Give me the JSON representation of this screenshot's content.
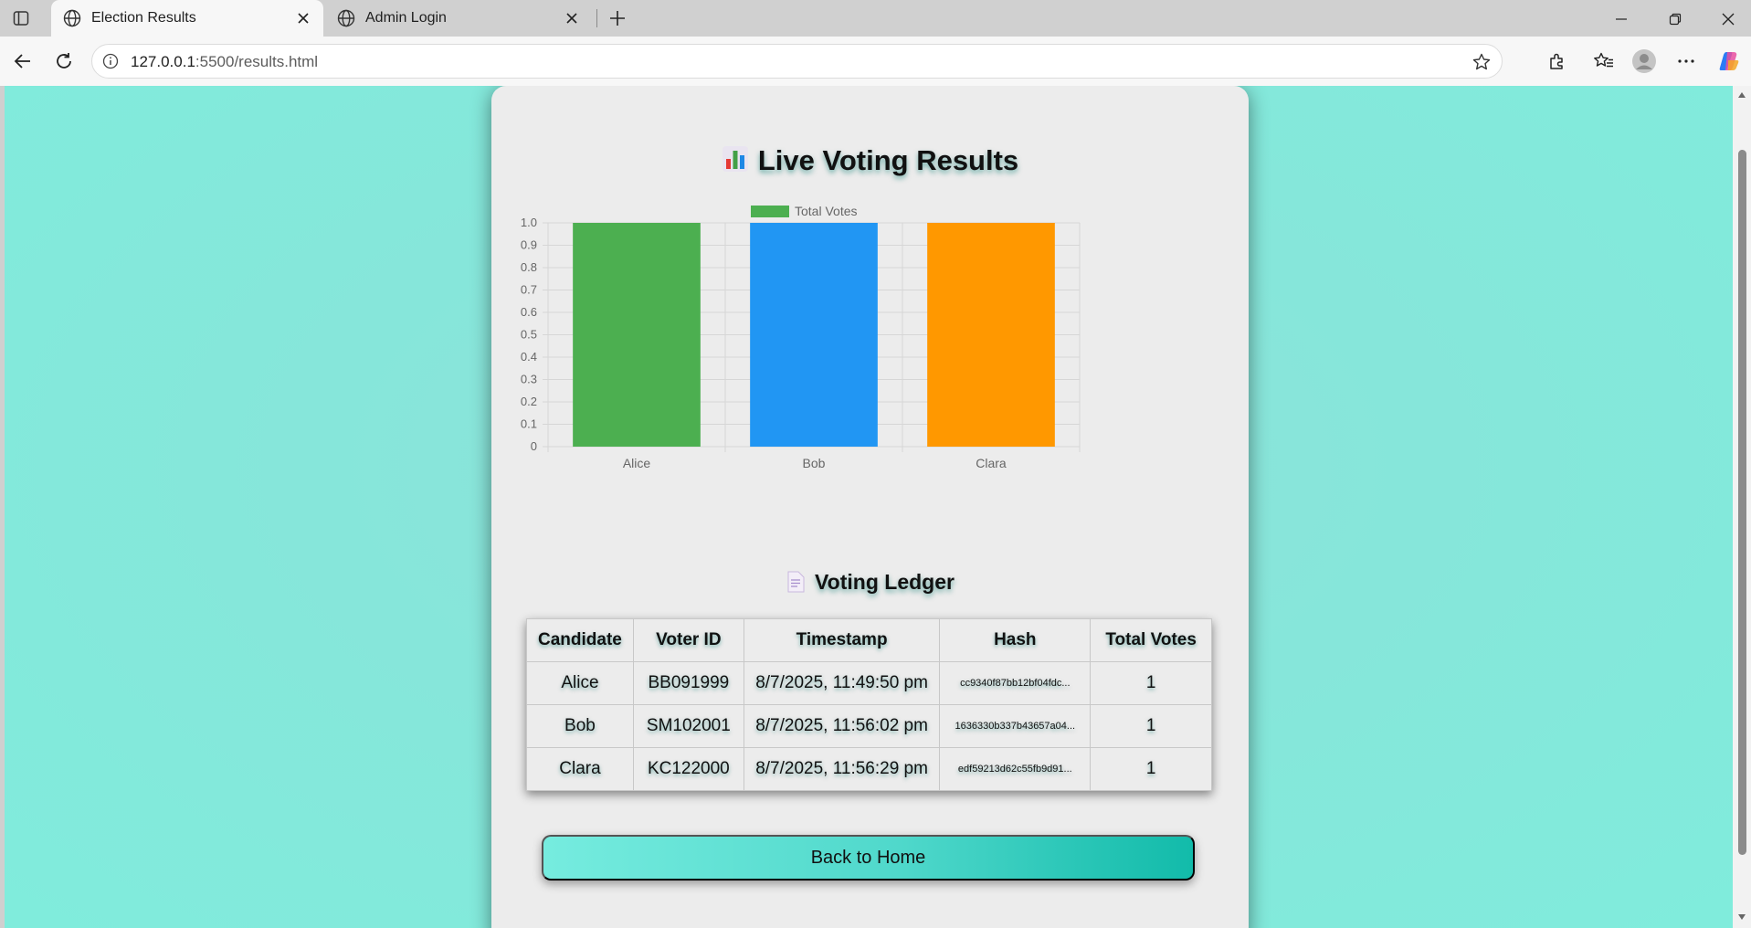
{
  "browser": {
    "tabs": [
      {
        "title": "Election Results",
        "active": true
      },
      {
        "title": "Admin Login",
        "active": false
      }
    ],
    "url": {
      "host": "127.0.0.1",
      "path": ":5500/results.html"
    }
  },
  "page": {
    "title": "Live Voting Results",
    "ledger_title": "Voting Ledger",
    "back_button": "Back to Home"
  },
  "chart_data": {
    "type": "bar",
    "categories": [
      "Alice",
      "Bob",
      "Clara"
    ],
    "series": [
      {
        "name": "Total Votes",
        "values": [
          1,
          1,
          1
        ],
        "colors": [
          "#4caf50",
          "#2196f3",
          "#ff9800"
        ]
      }
    ],
    "ylim": [
      0,
      1
    ],
    "yticks": [
      "0",
      "0.1",
      "0.2",
      "0.3",
      "0.4",
      "0.5",
      "0.6",
      "0.7",
      "0.8",
      "0.9",
      "1.0"
    ],
    "legend": "top",
    "grid": true
  },
  "ledger": {
    "headers": [
      "Candidate",
      "Voter ID",
      "Timestamp",
      "Hash",
      "Total Votes"
    ],
    "rows": [
      [
        "Alice",
        "BB091999",
        "8/7/2025, 11:49:50 pm",
        "cc9340f87bb12bf04fdc...",
        "1"
      ],
      [
        "Bob",
        "SM102001",
        "8/7/2025, 11:56:02 pm",
        "1636330b337b43657a04...",
        "1"
      ],
      [
        "Clara",
        "KC122000",
        "8/7/2025, 11:56:29 pm",
        "edf59213d62c55fb9d91...",
        "1"
      ]
    ]
  },
  "colors": {
    "background": "#84e8da",
    "card": "#ececec",
    "button_gradient_start": "#76ecdf",
    "button_gradient_end": "#12bbaa"
  }
}
